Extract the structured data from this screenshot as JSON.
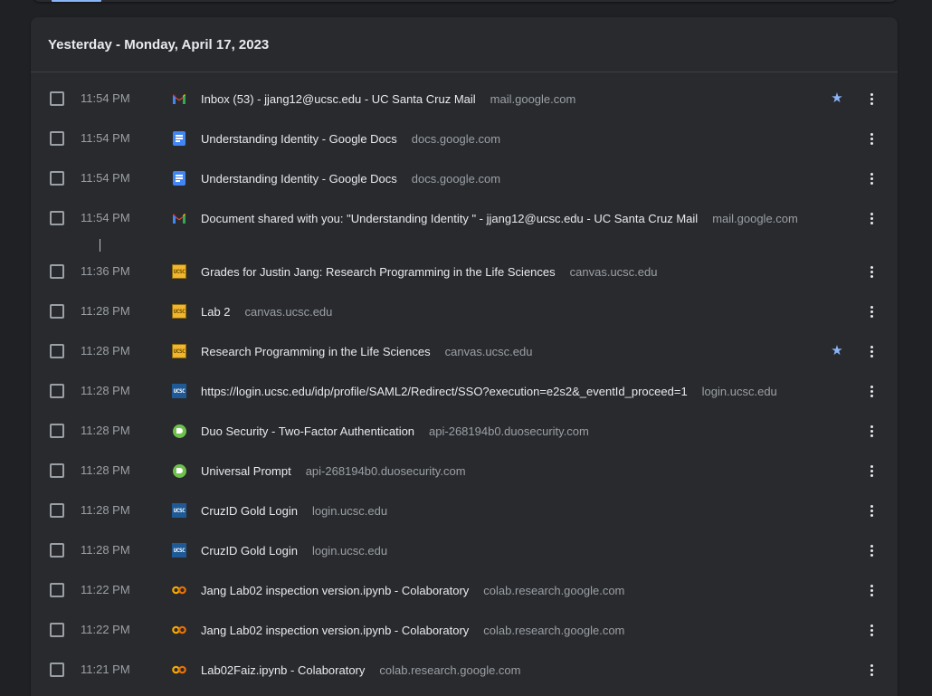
{
  "header": {
    "date_label": "Yesterday - Monday, April 17, 2023"
  },
  "colors": {
    "accent": "#8ab4f8",
    "background": "#202124",
    "card": "#292a2d"
  },
  "entries": [
    {
      "time": "11:54 PM",
      "icon": "gmail-icon",
      "title": "Inbox (53) - jjang12@ucsc.edu - UC Santa Cruz Mail",
      "domain": "mail.google.com",
      "starred": true
    },
    {
      "time": "11:54 PM",
      "icon": "google-docs-icon",
      "title": "Understanding Identity - Google Docs",
      "domain": "docs.google.com",
      "starred": false
    },
    {
      "time": "11:54 PM",
      "icon": "google-docs-icon",
      "title": "Understanding Identity - Google Docs",
      "domain": "docs.google.com",
      "starred": false
    },
    {
      "time": "11:54 PM",
      "icon": "gmail-icon",
      "title": "Document shared with you: \"Understanding Identity \" - jjang12@ucsc.edu - UC Santa Cruz Mail",
      "domain": "mail.google.com",
      "starred": false
    },
    {
      "time": "11:36 PM",
      "icon": "ucsc-canvas-icon",
      "title": "Grades for Justin Jang: Research Programming in the Life Sciences",
      "domain": "canvas.ucsc.edu",
      "starred": false
    },
    {
      "time": "11:28 PM",
      "icon": "ucsc-canvas-icon",
      "title": "Lab 2",
      "domain": "canvas.ucsc.edu",
      "starred": false
    },
    {
      "time": "11:28 PM",
      "icon": "ucsc-canvas-icon",
      "title": "Research Programming in the Life Sciences",
      "domain": "canvas.ucsc.edu",
      "starred": true
    },
    {
      "time": "11:28 PM",
      "icon": "ucsc-login-icon",
      "title": "https://login.ucsc.edu/idp/profile/SAML2/Redirect/SSO?execution=e2s2&_eventId_proceed=1",
      "domain": "login.ucsc.edu",
      "starred": false
    },
    {
      "time": "11:28 PM",
      "icon": "duo-security-icon",
      "title": "Duo Security - Two-Factor Authentication",
      "domain": "api-268194b0.duosecurity.com",
      "starred": false
    },
    {
      "time": "11:28 PM",
      "icon": "duo-security-icon",
      "title": "Universal Prompt",
      "domain": "api-268194b0.duosecurity.com",
      "starred": false
    },
    {
      "time": "11:28 PM",
      "icon": "ucsc-login-icon",
      "title": "CruzID Gold Login",
      "domain": "login.ucsc.edu",
      "starred": false
    },
    {
      "time": "11:28 PM",
      "icon": "ucsc-login-icon",
      "title": "CruzID Gold Login",
      "domain": "login.ucsc.edu",
      "starred": false
    },
    {
      "time": "11:22 PM",
      "icon": "colab-icon",
      "title": "Jang Lab02 inspection version.ipynb - Colaboratory",
      "domain": "colab.research.google.com",
      "starred": false
    },
    {
      "time": "11:22 PM",
      "icon": "colab-icon",
      "title": "Jang Lab02 inspection version.ipynb - Colaboratory",
      "domain": "colab.research.google.com",
      "starred": false
    },
    {
      "time": "11:21 PM",
      "icon": "colab-icon",
      "title": "Lab02Faiz.ipynb - Colaboratory",
      "domain": "colab.research.google.com",
      "starred": false
    }
  ]
}
